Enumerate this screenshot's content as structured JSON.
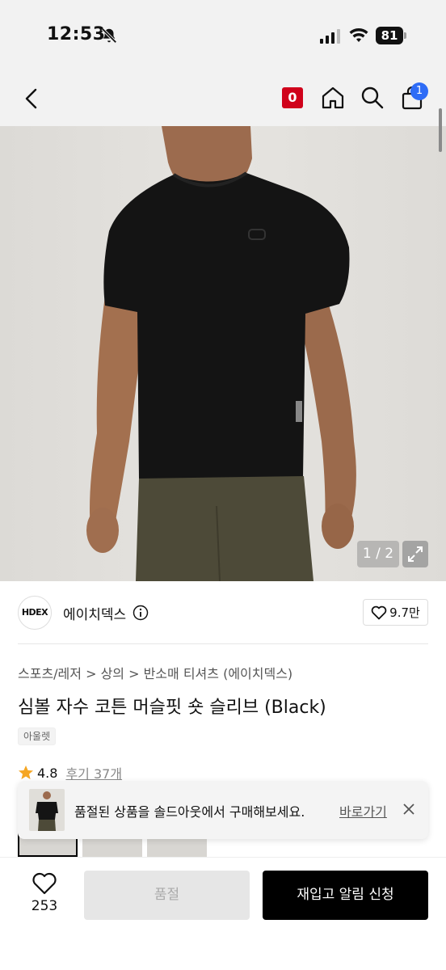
{
  "status_bar": {
    "time": "12:53",
    "battery": "81"
  },
  "nav": {
    "cart_badge": "0",
    "bag_count": "1"
  },
  "hero": {
    "counter": "1 / 2"
  },
  "brand": {
    "logo_text": "HDEX",
    "name": "에이치덱스",
    "likes": "9.7만"
  },
  "product": {
    "breadcrumb": "스포츠/레저 > 상의 > 반소매 티셔츠 (에이치덱스)",
    "title": "심볼 자수 코튼 머슬핏 숏 슬리브 (Black)",
    "tag": "아울렛",
    "rating": "4.8",
    "reviews": "후기 37개"
  },
  "toast": {
    "message": "품절된 상품을 솔드아웃에서 구매해보세요.",
    "link": "바로가기"
  },
  "bottom": {
    "wish_count": "253",
    "sold_out_label": "품절",
    "restock_label": "재입고 알림 신청"
  },
  "colors": {
    "accent_red": "#d0021b",
    "badge_blue": "#2e6cf6",
    "primary_black": "#000000"
  }
}
